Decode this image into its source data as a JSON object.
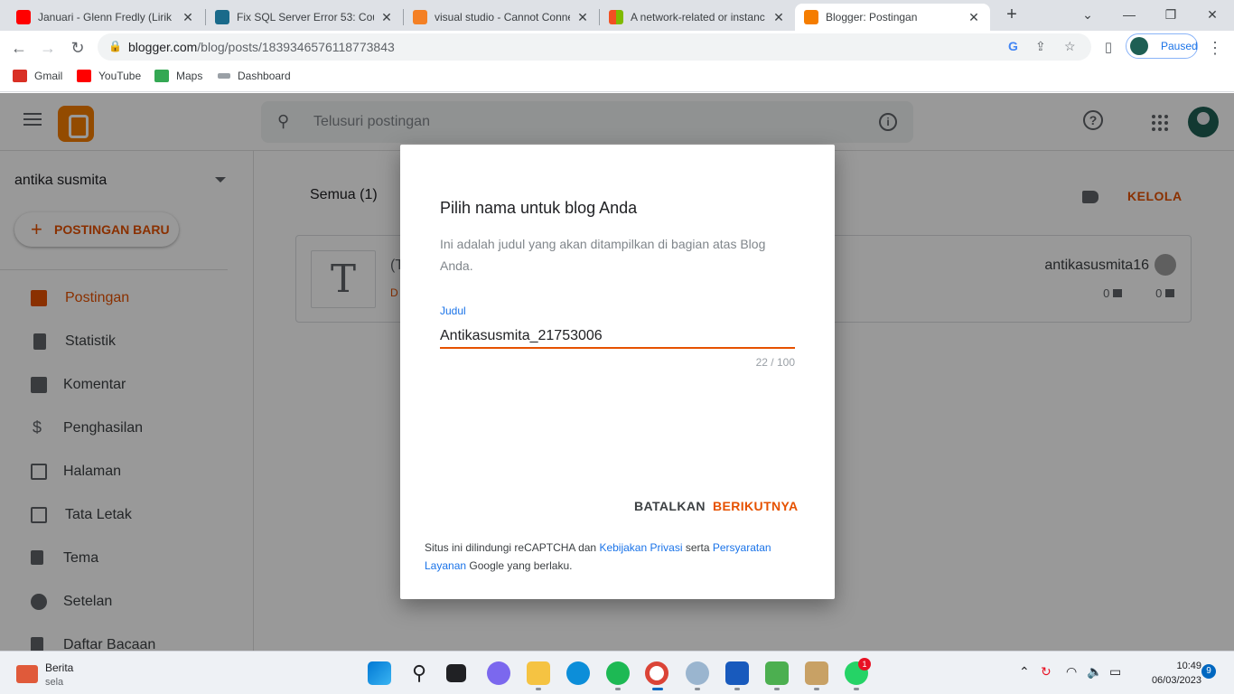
{
  "browser": {
    "tabs": [
      {
        "title": "Januari - Glenn Fredly (Lirik L",
        "favicon": "youtube-icon",
        "color": "#ff0000"
      },
      {
        "title": "Fix SQL Server Error 53: Coul",
        "favicon": "t-site-icon",
        "color": "#1a6a8a"
      },
      {
        "title": "visual studio - Cannot Conne",
        "favicon": "stackoverflow-icon",
        "color": "#f48024"
      },
      {
        "title": "A network-related or instanc",
        "favicon": "microsoft-icon",
        "color": "#f25022"
      },
      {
        "title": "Blogger: Postingan",
        "favicon": "blogger-icon",
        "color": "#f57d00",
        "active": true
      }
    ],
    "url_domain": "blogger.com",
    "url_path": "/blog/posts/1839346576118773843",
    "profile_status": "Paused",
    "bookmarks": [
      {
        "label": "Gmail",
        "icon": "gmail-icon",
        "color": "#d93025"
      },
      {
        "label": "YouTube",
        "icon": "youtube-icon",
        "color": "#ff0000"
      },
      {
        "label": "Maps",
        "icon": "maps-icon",
        "color": "#34a853"
      },
      {
        "label": "Dashboard",
        "icon": "dashboard-icon",
        "color": "#5f6368"
      }
    ]
  },
  "blogger": {
    "search_placeholder": "Telusuri postingan",
    "blog_name": "antika susmita",
    "new_post": "POSTINGAN BARU",
    "nav": [
      {
        "label": "Postingan",
        "icon": "posts-icon",
        "active": true
      },
      {
        "label": "Statistik",
        "icon": "stats-icon"
      },
      {
        "label": "Komentar",
        "icon": "comment-icon"
      },
      {
        "label": "Penghasilan",
        "icon": "dollar-icon"
      },
      {
        "label": "Halaman",
        "icon": "pages-icon"
      },
      {
        "label": "Tata Letak",
        "icon": "layout-icon"
      },
      {
        "label": "Tema",
        "icon": "theme-icon"
      },
      {
        "label": "Setelan",
        "icon": "settings-icon"
      },
      {
        "label": "Daftar Bacaan",
        "icon": "bookmark-icon"
      }
    ],
    "filter_label": "Semua (1)",
    "manage": "KELOLA",
    "post": {
      "thumb_letter": "T",
      "title_fragment": "(T",
      "status_fragment": "D",
      "author": "antikasusmita16",
      "comments": "0",
      "views": "0"
    }
  },
  "dialog": {
    "title": "Pilih nama untuk blog Anda",
    "description": "Ini adalah judul yang akan ditampilkan di bagian atas Blog Anda.",
    "field_label": "Judul",
    "field_value": "Antikasusmita_21753006",
    "counter": "22 / 100",
    "cancel": "BATALKAN",
    "next": "BERIKUTNYA",
    "recaptcha_prefix": "Situs ini dilindungi reCAPTCHA dan",
    "privacy_link": "Kebijakan Privasi",
    "and_word": "serta",
    "terms_link": "Persyaratan Layanan",
    "recaptcha_suffix": "Google yang berlaku."
  },
  "taskbar": {
    "news_title": "Berita",
    "news_sub": "sela",
    "time": "10:49",
    "date": "06/03/2023",
    "notification_count": "9",
    "whatsapp_badge": "1"
  },
  "colors": {
    "accent": "#e65100",
    "link": "#1a73e8"
  }
}
